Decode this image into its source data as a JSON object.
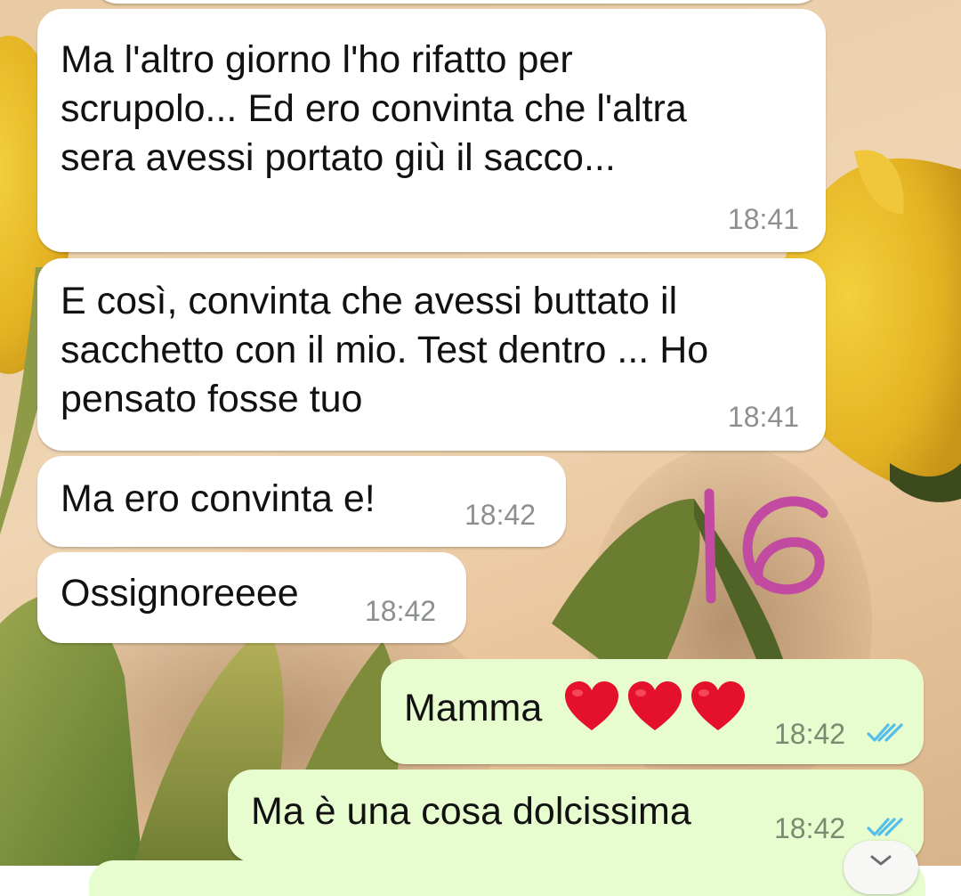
{
  "chat": {
    "messages": [
      {
        "direction": "incoming",
        "text": "Ma l'altro giorno l'ho rifatto per\nscrupolo... Ed ero convinta che l'altra\nsera avessi portato giù il sacco...",
        "time": "18:41"
      },
      {
        "direction": "incoming",
        "text": "E così, convinta che avessi buttato il\nsacchetto con il mio. Test dentro ... Ho\npensato fosse tuo",
        "time": "18:41"
      },
      {
        "direction": "incoming",
        "text": "Ma ero convinta e!",
        "time": "18:42"
      },
      {
        "direction": "incoming",
        "text": "Ossignoreeee",
        "time": "18:42"
      },
      {
        "direction": "outgoing",
        "text": "Mamma",
        "emoji": "❤️❤️❤️",
        "time": "18:42",
        "status": "read"
      },
      {
        "direction": "outgoing",
        "text": "Ma è una cosa dolcissima",
        "time": "18:42",
        "status": "read"
      }
    ]
  },
  "annotation": {
    "text": "16",
    "color": "#c24aa0"
  },
  "colors": {
    "incoming_bubble": "#ffffff",
    "outgoing_bubble": "#e7fccf",
    "read_ticks": "#53bdeb",
    "heart": "#e5102b"
  },
  "icons": {
    "read_receipt": "double-check-icon",
    "scroll_down": "chevron-down-icon"
  }
}
